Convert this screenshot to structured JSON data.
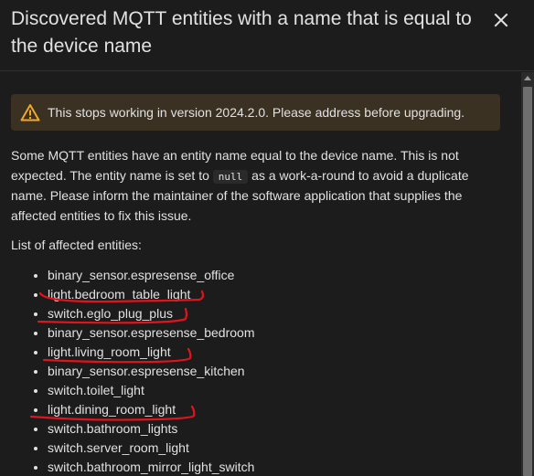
{
  "dialog": {
    "title": "Discovered MQTT entities with a name that is equal to the device name",
    "close_icon": "close-icon"
  },
  "warning": {
    "icon": "warning-triangle-icon",
    "text": "This stops working in version 2024.2.0. Please address before upgrading."
  },
  "description": {
    "part1": "Some MQTT entities have an entity name equal to the device name. This is not expected. The entity name is set to",
    "code": "null",
    "part2": "as a work-a-round to avoid a duplicate name. Please inform the maintainer of the software application that supplies the affected entities to fix this issue."
  },
  "list_heading": "List of affected entities:",
  "entities": [
    "binary_sensor.espresense_office",
    "light.bedroom_table_light",
    "switch.eglo_plug_plus",
    "binary_sensor.espresense_bedroom",
    "light.living_room_light",
    "binary_sensor.espresense_kitchen",
    "switch.toilet_light",
    "light.dining_room_light",
    "switch.bathroom_lights",
    "switch.server_room_light",
    "switch.bathroom_mirror_light_switch"
  ],
  "highlighted_entities": [
    "light.bedroom_table_light",
    "switch.eglo_plug_plus",
    "light.living_room_light",
    "light.dining_room_light"
  ],
  "colors": {
    "background": "#1c1c1c",
    "warning_background": "#3b3122",
    "warning_icon": "#f0a82a",
    "annotation_red": "#e0141c",
    "text": "#e1e1e1"
  }
}
